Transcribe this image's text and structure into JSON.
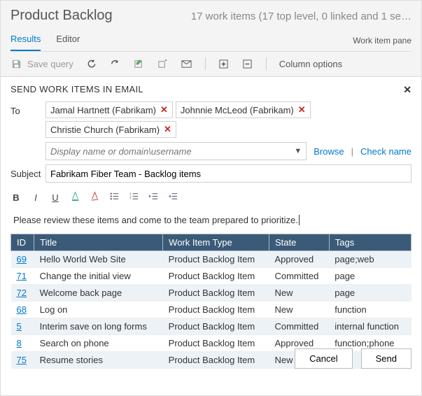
{
  "header": {
    "title": "Product Backlog",
    "summary": "17 work items (17 top level, 0 linked and 1 se…",
    "tabs": [
      "Results",
      "Editor"
    ],
    "pane_label": "Work item pane"
  },
  "toolbar": {
    "save_label": "Save query",
    "column_options": "Column options"
  },
  "dialog": {
    "title": "SEND WORK ITEMS IN EMAIL",
    "to_label": "To",
    "subject_label": "Subject",
    "recipients": [
      "Jamal Hartnett (Fabrikam)",
      "Johnnie McLeod (Fabrikam)",
      "Christie Church (Fabrikam)"
    ],
    "name_placeholder": "Display name or domain\\username",
    "browse": "Browse",
    "check_name": "Check name",
    "subject_value": "Fabrikam Fiber Team - Backlog items",
    "message": "Please review these items and come to the team prepared to prioritize.",
    "table": {
      "headers": [
        "ID",
        "Title",
        "Work Item Type",
        "State",
        "Tags"
      ],
      "rows": [
        {
          "id": "69",
          "title": "Hello World Web Site",
          "type": "Product Backlog Item",
          "state": "Approved",
          "tags": "page;web"
        },
        {
          "id": "71",
          "title": "Change the initial view",
          "type": "Product Backlog Item",
          "state": "Committed",
          "tags": "page"
        },
        {
          "id": "72",
          "title": "Welcome back page",
          "type": "Product Backlog Item",
          "state": "New",
          "tags": "page"
        },
        {
          "id": "68",
          "title": "Log on",
          "type": "Product Backlog Item",
          "state": "New",
          "tags": "function"
        },
        {
          "id": "5",
          "title": "Interim save on long forms",
          "type": "Product Backlog Item",
          "state": "Committed",
          "tags": "internal function"
        },
        {
          "id": "8",
          "title": "Search on phone",
          "type": "Product Backlog Item",
          "state": "Approved",
          "tags": "function;phone"
        },
        {
          "id": "75",
          "title": "Resume stories",
          "type": "Product Backlog Item",
          "state": "New",
          "tags": ""
        }
      ]
    },
    "cancel": "Cancel",
    "send": "Send"
  }
}
